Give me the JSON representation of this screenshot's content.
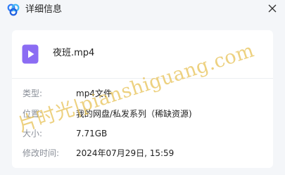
{
  "window": {
    "title": "详细信息"
  },
  "icons": {
    "app_logo": "baidu-netdisk-cloud-icon",
    "close": "close-icon",
    "file": "video-file-icon"
  },
  "colors": {
    "logo_primary": "#2f7cf6",
    "file_icon": "#8b6cf3",
    "label": "#8a8f98",
    "watermark": "#e8c45c"
  },
  "file": {
    "name": "夜班.mp4"
  },
  "details": {
    "type": {
      "label": "类型:",
      "value": "mp4文件"
    },
    "location": {
      "label": "位置:",
      "value": "我的网盘/私发系列（稀缺资源)"
    },
    "size": {
      "label": "大小:",
      "value": "7.71GB"
    },
    "modified": {
      "label": "修改时间:",
      "value": "2024年07月29日, 15:59"
    }
  },
  "watermark": {
    "text": "片时光|pianshiguang.com"
  }
}
